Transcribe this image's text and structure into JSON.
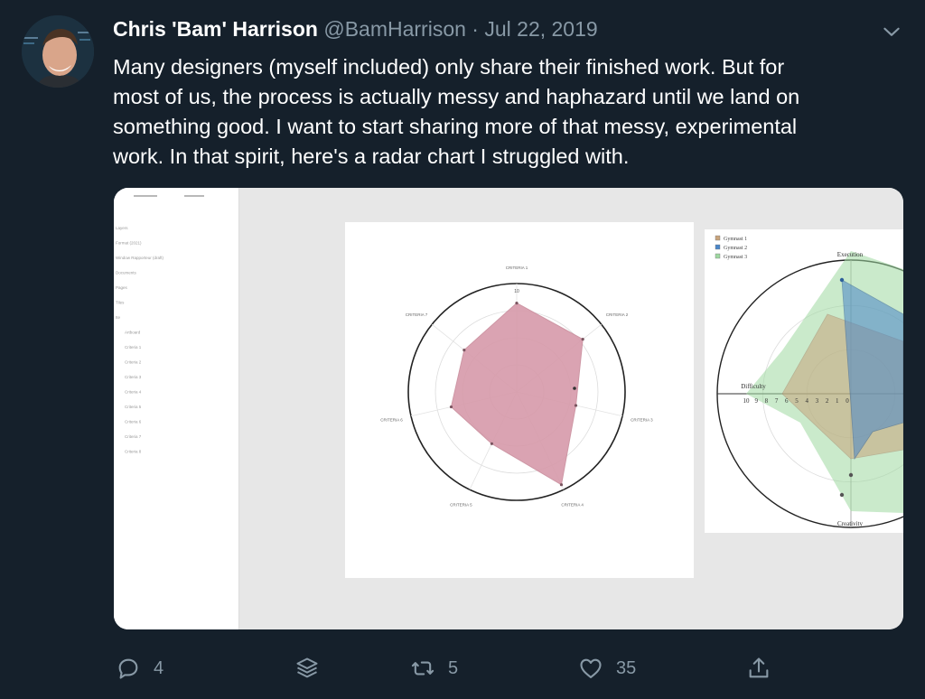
{
  "tweet": {
    "author_name": "Chris 'Bam' Harrison",
    "handle": "@BamHarrison",
    "separator": "·",
    "date": "Jul 22, 2019",
    "text_lines": [
      "Many designers (myself included) only share their finished work. But for",
      "most of us, the process is actually messy and haphazard until we land on",
      "something good. I want to start sharing more of that messy, experimental",
      "work. In that spirit, here's a radar chart I struggled with."
    ]
  },
  "media": {
    "left_chart": {
      "axis_labels": [
        "CRITERIA 1",
        "CRITERIA 2",
        "CRITERIA 3",
        "CRITERIA 4",
        "CRITERIA 5",
        "CRITERIA 6",
        "CRITERIA 7"
      ],
      "center_value": "10",
      "fill_color": "#d79aaa"
    },
    "right_chart": {
      "legend": [
        "Gymnast 1",
        "Gymnast 2",
        "Gymnast 3"
      ],
      "legend_colors": [
        "#c8a47c",
        "#4a86c8",
        "#9ed8a0"
      ],
      "axis_top": "Execution",
      "axis_left": "Difficulty",
      "axis_bottom": "Creativity",
      "scale_ticks": [
        "10",
        "9",
        "8",
        "7",
        "6",
        "5",
        "4",
        "3",
        "2",
        "1",
        "0"
      ]
    },
    "sidebar_items": [
      "Layers",
      "Format (2021)",
      "Window Rapporteur (draft)",
      "Documents",
      "Pages",
      "Tiles",
      "Ite",
      "Artboard",
      "Criteria 1",
      "Criteria 2",
      "Criteria 3",
      "Criteria 4",
      "Criteria 5",
      "Criteria 6",
      "Criteria 7",
      "Criteria 8"
    ]
  },
  "actions": {
    "reply_count": "4",
    "retweet_count": "5",
    "like_count": "35"
  },
  "colors": {
    "background": "#15202b",
    "secondary_text": "#8899a6"
  },
  "icons": [
    "chevron-down-icon",
    "reply-icon",
    "layers-icon",
    "retweet-icon",
    "heart-icon",
    "share-icon"
  ]
}
